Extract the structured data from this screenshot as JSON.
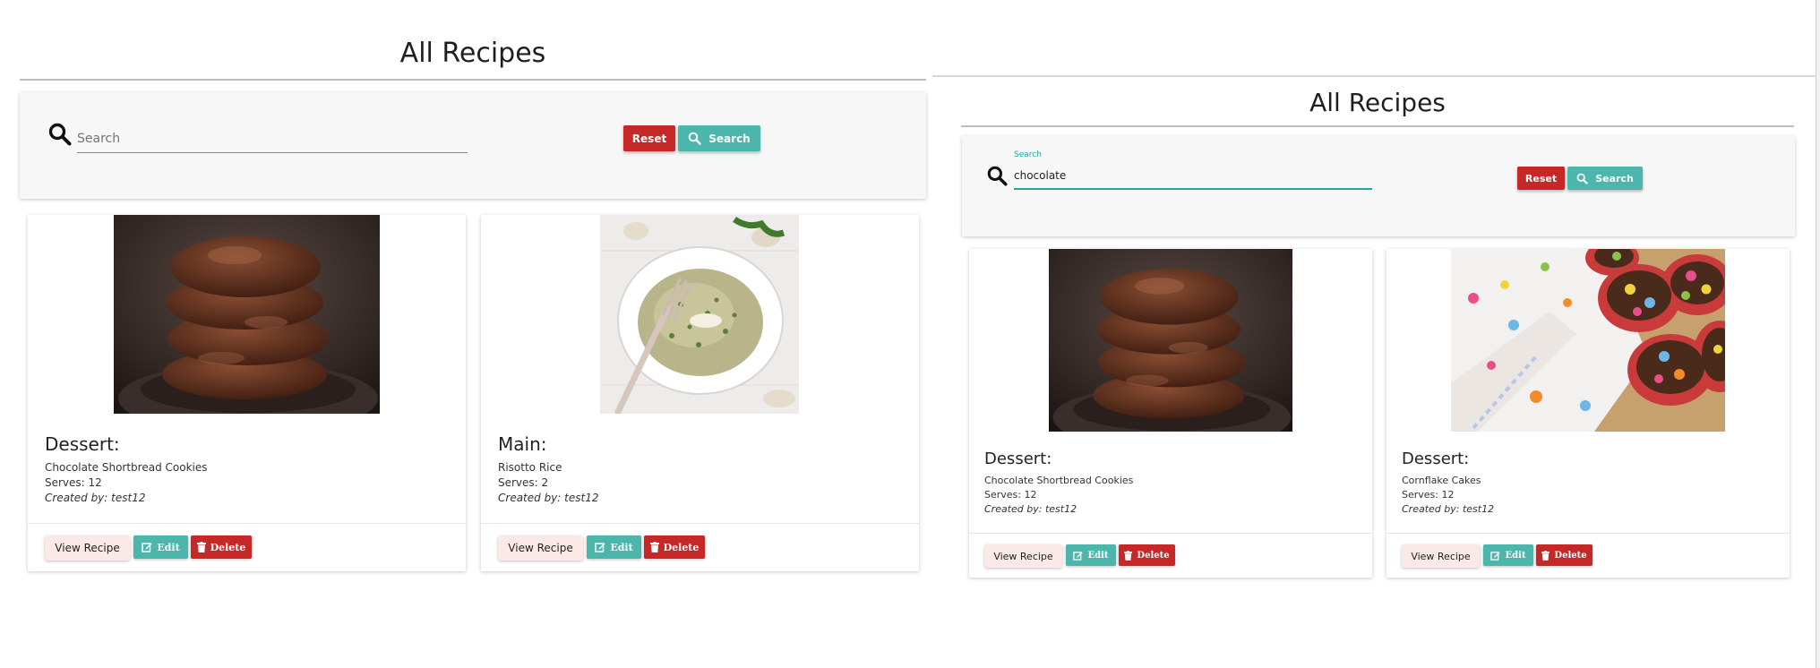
{
  "left": {
    "page_title": "All Recipes",
    "search": {
      "placeholder": "Search",
      "value": ""
    },
    "reset_label": "Reset",
    "search_label": "Search",
    "cards": [
      {
        "category": "Dessert:",
        "name": "Chocolate Shortbread Cookies",
        "serves": "Serves: 12",
        "author": "Created by: test12",
        "image": "chocolate-cookies-image",
        "view_label": "View Recipe",
        "edit_label": "Edit",
        "delete_label": "Delete"
      },
      {
        "category": "Main:",
        "name": "Risotto Rice",
        "serves": "Serves: 2",
        "author": "Created by: test12",
        "image": "risotto-bowl-image",
        "view_label": "View Recipe",
        "edit_label": "Edit",
        "delete_label": "Delete"
      }
    ]
  },
  "right": {
    "page_title": "All Recipes",
    "search": {
      "label": "Search",
      "value": "chocolate"
    },
    "reset_label": "Reset",
    "search_label": "Search",
    "cards": [
      {
        "category": "Dessert:",
        "name": "Chocolate Shortbread Cookies",
        "serves": "Serves: 12",
        "author": "Created by: test12",
        "image": "chocolate-cookies-image",
        "view_label": "View Recipe",
        "edit_label": "Edit",
        "delete_label": "Delete"
      },
      {
        "category": "Dessert:",
        "name": "Cornflake Cakes",
        "serves": "Serves: 12",
        "author": "Created by: test12",
        "image": "cornflake-cakes-image",
        "view_label": "View Recipe",
        "edit_label": "Edit",
        "delete_label": "Delete"
      }
    ]
  },
  "colors": {
    "accent_teal": "#4db6ac",
    "danger_red": "#c62828",
    "focus_teal": "#26a69a",
    "view_button_bg": "#fbe9e7"
  },
  "icons": {
    "search": "search-icon",
    "edit": "edit-icon",
    "delete": "trash-icon"
  }
}
